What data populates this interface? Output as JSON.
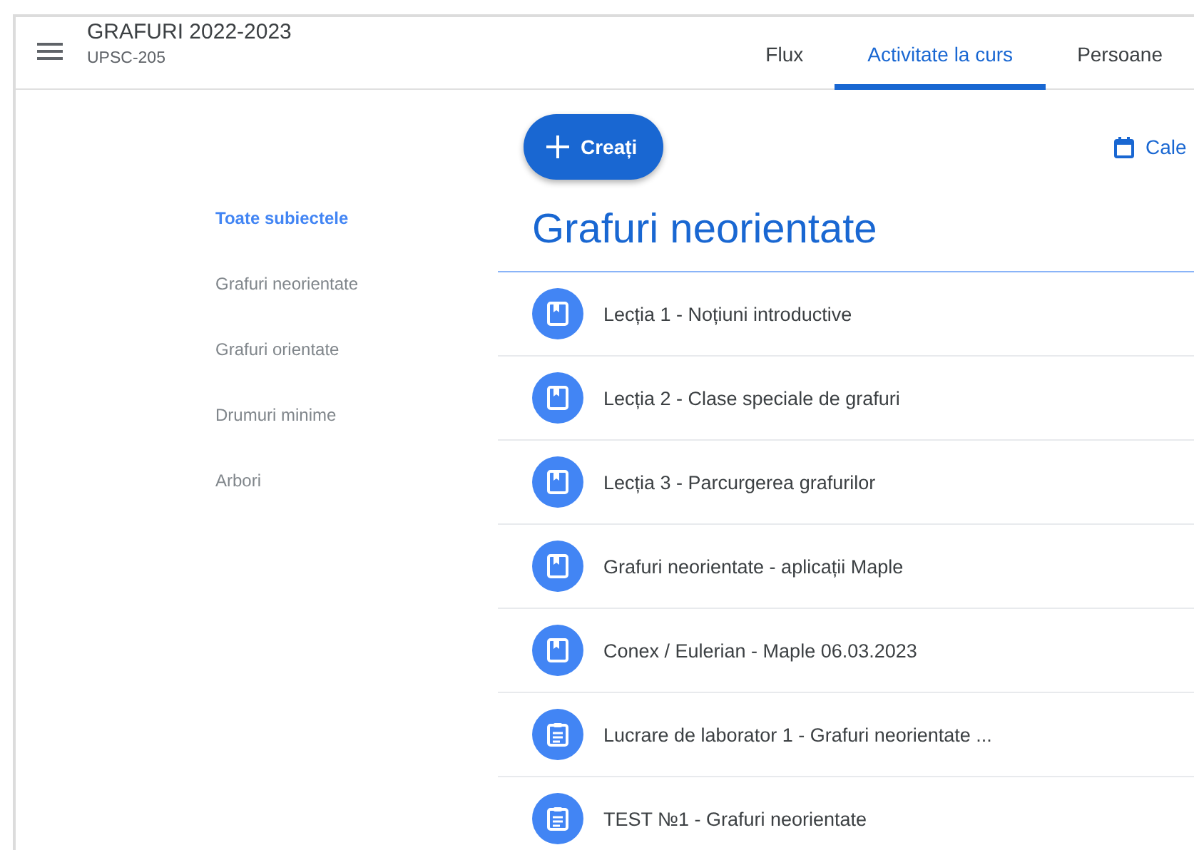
{
  "header": {
    "title": "GRAFURI 2022-2023",
    "subtitle": "UPSC-205"
  },
  "tabs": [
    {
      "label": "Flux",
      "selected": false
    },
    {
      "label": "Activitate la curs",
      "selected": true
    },
    {
      "label": "Persoane",
      "selected": false
    }
  ],
  "create_button": {
    "label": "Creați"
  },
  "calendar_link": {
    "label": "Cale"
  },
  "topics": [
    {
      "label": "Toate subiectele",
      "selected": true
    },
    {
      "label": "Grafuri neorientate",
      "selected": false
    },
    {
      "label": "Grafuri orientate",
      "selected": false
    },
    {
      "label": "Drumuri minime",
      "selected": false
    },
    {
      "label": "Arbori",
      "selected": false
    }
  ],
  "section": {
    "title": "Grafuri neorientate",
    "items": [
      {
        "kind": "material",
        "title": "Lecția 1 - Noțiuni introductive"
      },
      {
        "kind": "material",
        "title": "Lecția 2 - Clase speciale de grafuri"
      },
      {
        "kind": "material",
        "title": "Lecția 3 - Parcurgerea grafurilor"
      },
      {
        "kind": "material",
        "title": "Grafuri neorientate - aplicații Maple"
      },
      {
        "kind": "material",
        "title": "Conex / Eulerian - Maple 06.03.2023"
      },
      {
        "kind": "assignment",
        "title": "Lucrare de laborator 1 - Grafuri neorientate ..."
      },
      {
        "kind": "assignment",
        "title": "TEST №1 - Grafuri neorientate"
      }
    ]
  }
}
